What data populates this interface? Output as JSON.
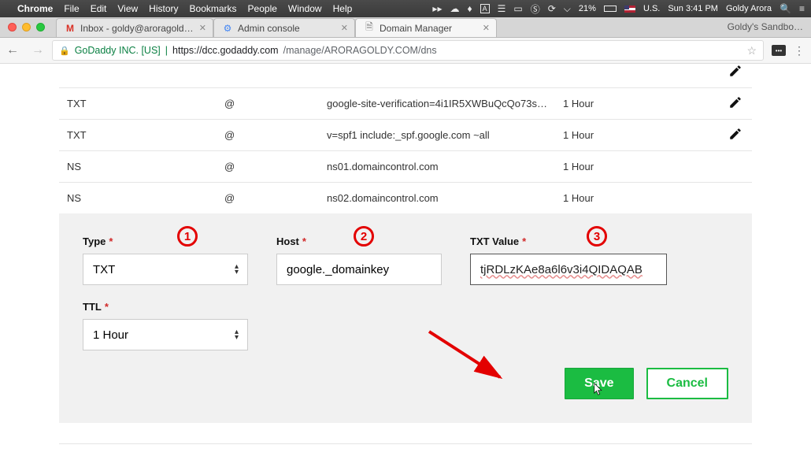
{
  "menubar": {
    "app": "Chrome",
    "items": [
      "File",
      "Edit",
      "View",
      "History",
      "Bookmarks",
      "People",
      "Window",
      "Help"
    ],
    "right": {
      "battery": "21%",
      "locale": "U.S.",
      "clock": "Sun 3:41 PM",
      "user": "Goldy Arora"
    }
  },
  "chrome": {
    "tabs": [
      {
        "title": "Inbox - goldy@aroragoldy.com"
      },
      {
        "title": "Admin console"
      },
      {
        "title": "Domain Manager"
      }
    ],
    "active_tab_index": 2,
    "account_label": "Goldy's Sandbo…",
    "url_org": "GoDaddy INC. [US]",
    "url_host": "https://dcc.godaddy.com",
    "url_path": "/manage/ARORAGOLDY.COM/dns"
  },
  "dns": {
    "rows": [
      {
        "type": "",
        "host": "",
        "value": "",
        "ttl": "",
        "edit": true,
        "partial": true
      },
      {
        "type": "TXT",
        "host": "@",
        "value": "google-site-verification=4i1IR5XWBuQcQo73s…",
        "ttl": "1 Hour",
        "edit": true
      },
      {
        "type": "TXT",
        "host": "@",
        "value": "v=spf1 include:_spf.google.com ~all",
        "ttl": "1 Hour",
        "edit": true
      },
      {
        "type": "NS",
        "host": "@",
        "value": "ns01.domaincontrol.com",
        "ttl": "1 Hour",
        "edit": false
      },
      {
        "type": "NS",
        "host": "@",
        "value": "ns02.domaincontrol.com",
        "ttl": "1 Hour",
        "edit": false
      }
    ]
  },
  "form": {
    "type_label": "Type",
    "type_value": "TXT",
    "host_label": "Host",
    "host_value": "google._domainkey",
    "txt_label": "TXT Value",
    "txt_value": "tjRDLzKAe8a6l6v3i4QIDAQAB",
    "ttl_label": "TTL",
    "ttl_value": "1 Hour",
    "save": "Save",
    "cancel": "Cancel"
  },
  "annotations": {
    "c1": "1",
    "c2": "2",
    "c3": "3"
  }
}
